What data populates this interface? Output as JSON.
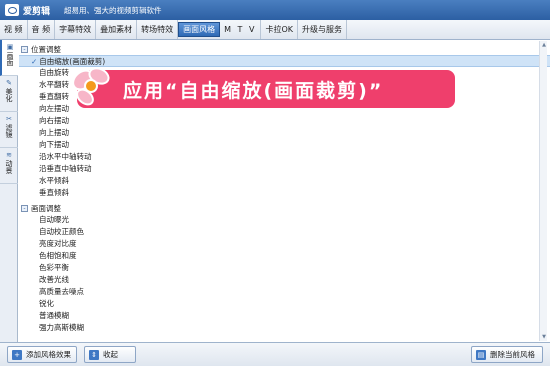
{
  "app": {
    "name": "爱剪辑",
    "slogan": "超易用、强大的视频剪辑软件"
  },
  "menu": {
    "items": [
      {
        "label": "视 频"
      },
      {
        "label": "音 频"
      },
      {
        "label": "字幕特效"
      },
      {
        "label": "叠加素材"
      },
      {
        "label": "转场特效"
      },
      {
        "label": "画面风格",
        "active": true
      },
      {
        "label": "M T V"
      },
      {
        "label": "卡拉OK"
      },
      {
        "label": "升级与服务"
      }
    ]
  },
  "sidebar": {
    "tabs": [
      {
        "label": "画面",
        "active": true
      },
      {
        "label": "美化"
      },
      {
        "label": "滤镜"
      },
      {
        "label": "动景"
      }
    ]
  },
  "groups": [
    {
      "title": "位置调整",
      "toggle": "-",
      "items": [
        {
          "label": "自由缩放(画面裁剪)",
          "selected": true
        },
        {
          "label": "自由旋转"
        },
        {
          "label": "水平翻转"
        },
        {
          "label": "垂直翻转"
        },
        {
          "label": "向左摆动"
        },
        {
          "label": "向右摆动"
        },
        {
          "label": "向上摆动"
        },
        {
          "label": "向下摆动"
        },
        {
          "label": "沿水平中轴转动"
        },
        {
          "label": "沿垂直中轴转动"
        },
        {
          "label": "水平倾斜"
        },
        {
          "label": "垂直倾斜"
        }
      ]
    },
    {
      "title": "画面调整",
      "toggle": "-",
      "items": [
        {
          "label": "自动曝光"
        },
        {
          "label": "自动校正颜色"
        },
        {
          "label": "亮度对比度"
        },
        {
          "label": "色相饱和度"
        },
        {
          "label": "色彩平衡"
        },
        {
          "label": "改善光线"
        },
        {
          "label": "高质量去噪点"
        },
        {
          "label": "锐化"
        },
        {
          "label": "普通模糊"
        },
        {
          "label": "强力高斯模糊"
        }
      ]
    }
  ],
  "banner": {
    "text": "应用“自由缩放(画面裁剪)”"
  },
  "buttons": {
    "add": "添加风格效果",
    "collapse": "收起",
    "delete": "删除当前风格"
  },
  "colors": {
    "accent": "#2f6ab5",
    "banner": "#ef3f6c"
  },
  "icons": {
    "check": "check-icon",
    "collapse": "collapse-icon",
    "add": "add-icon",
    "delete": "trash-icon"
  }
}
